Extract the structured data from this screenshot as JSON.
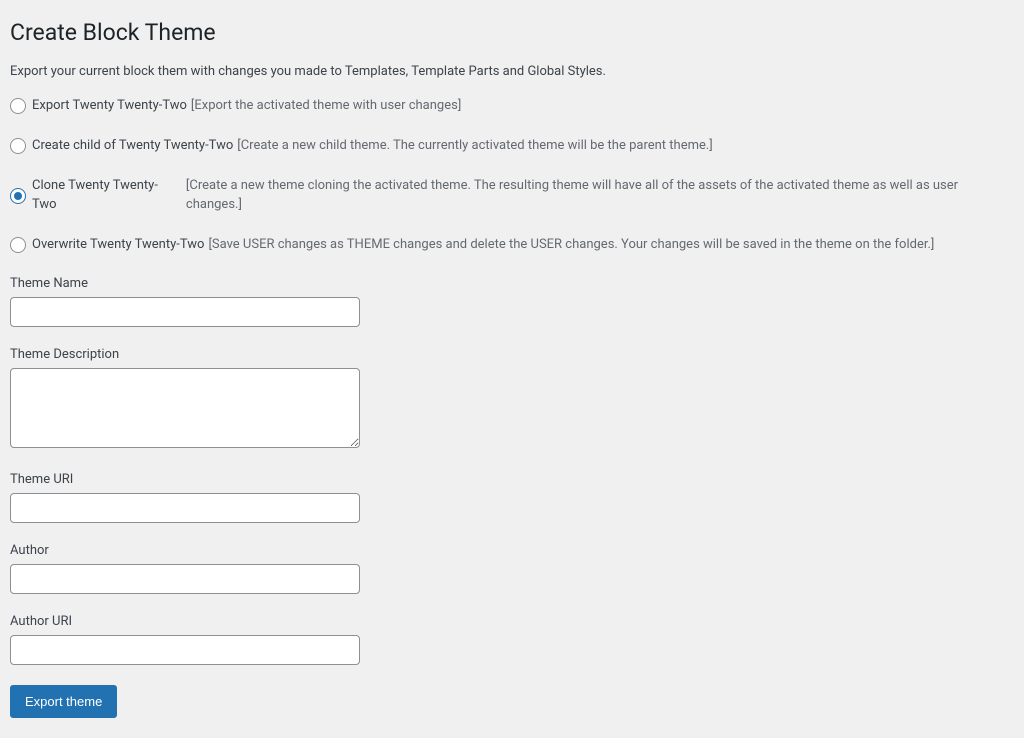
{
  "heading": "Create Block Theme",
  "intro": "Export your current block them with changes you made to Templates, Template Parts and Global Styles.",
  "options": [
    {
      "label": "Export Twenty Twenty-Two",
      "desc": "[Export the activated theme with user changes]",
      "checked": false
    },
    {
      "label": "Create child of Twenty Twenty-Two",
      "desc": "[Create a new child theme. The currently activated theme will be the parent theme.]",
      "checked": false
    },
    {
      "label": "Clone Twenty Twenty-Two",
      "desc": "[Create a new theme cloning the activated theme. The resulting theme will have all of the assets of the activated theme as well as user changes.]",
      "checked": true
    },
    {
      "label": "Overwrite Twenty Twenty-Two",
      "desc": "[Save USER changes as THEME changes and delete the USER changes. Your changes will be saved in the theme on the folder.]",
      "checked": false
    }
  ],
  "fields": {
    "theme_name": {
      "label": "Theme Name",
      "value": ""
    },
    "theme_description": {
      "label": "Theme Description",
      "value": ""
    },
    "theme_uri": {
      "label": "Theme URI",
      "value": ""
    },
    "author": {
      "label": "Author",
      "value": ""
    },
    "author_uri": {
      "label": "Author URI",
      "value": ""
    }
  },
  "submit_label": "Export theme"
}
